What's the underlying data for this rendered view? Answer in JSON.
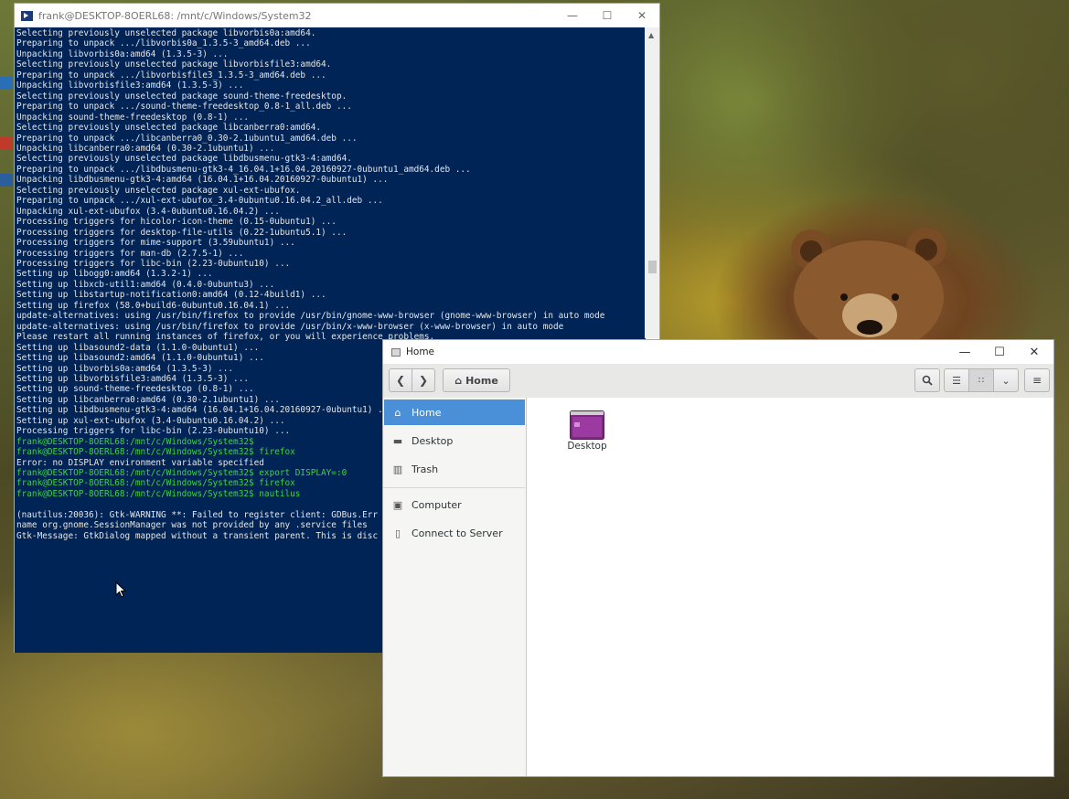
{
  "terminal": {
    "title": "frank@DESKTOP-8OERL68: /mnt/c/Windows/System32",
    "lines": [
      {
        "t": "Selecting previously unselected package libvorbis0a:amd64.",
        "c": "w"
      },
      {
        "t": "Preparing to unpack .../libvorbis0a_1.3.5-3_amd64.deb ...",
        "c": "w"
      },
      {
        "t": "Unpacking libvorbis0a:amd64 (1.3.5-3) ...",
        "c": "w"
      },
      {
        "t": "Selecting previously unselected package libvorbisfile3:amd64.",
        "c": "w"
      },
      {
        "t": "Preparing to unpack .../libvorbisfile3_1.3.5-3_amd64.deb ...",
        "c": "w"
      },
      {
        "t": "Unpacking libvorbisfile3:amd64 (1.3.5-3) ...",
        "c": "w"
      },
      {
        "t": "Selecting previously unselected package sound-theme-freedesktop.",
        "c": "w"
      },
      {
        "t": "Preparing to unpack .../sound-theme-freedesktop_0.8-1_all.deb ...",
        "c": "w"
      },
      {
        "t": "Unpacking sound-theme-freedesktop (0.8-1) ...",
        "c": "w"
      },
      {
        "t": "Selecting previously unselected package libcanberra0:amd64.",
        "c": "w"
      },
      {
        "t": "Preparing to unpack .../libcanberra0_0.30-2.1ubuntu1_amd64.deb ...",
        "c": "w"
      },
      {
        "t": "Unpacking libcanberra0:amd64 (0.30-2.1ubuntu1) ...",
        "c": "w"
      },
      {
        "t": "Selecting previously unselected package libdbusmenu-gtk3-4:amd64.",
        "c": "w"
      },
      {
        "t": "Preparing to unpack .../libdbusmenu-gtk3-4_16.04.1+16.04.20160927-0ubuntu1_amd64.deb ...",
        "c": "w"
      },
      {
        "t": "Unpacking libdbusmenu-gtk3-4:amd64 (16.04.1+16.04.20160927-0ubuntu1) ...",
        "c": "w"
      },
      {
        "t": "Selecting previously unselected package xul-ext-ubufox.",
        "c": "w"
      },
      {
        "t": "Preparing to unpack .../xul-ext-ubufox_3.4-0ubuntu0.16.04.2_all.deb ...",
        "c": "w"
      },
      {
        "t": "Unpacking xul-ext-ubufox (3.4-0ubuntu0.16.04.2) ...",
        "c": "w"
      },
      {
        "t": "Processing triggers for hicolor-icon-theme (0.15-0ubuntu1) ...",
        "c": "w"
      },
      {
        "t": "Processing triggers for desktop-file-utils (0.22-1ubuntu5.1) ...",
        "c": "w"
      },
      {
        "t": "Processing triggers for mime-support (3.59ubuntu1) ...",
        "c": "w"
      },
      {
        "t": "Processing triggers for man-db (2.7.5-1) ...",
        "c": "w"
      },
      {
        "t": "Processing triggers for libc-bin (2.23-0ubuntu10) ...",
        "c": "w"
      },
      {
        "t": "Setting up libogg0:amd64 (1.3.2-1) ...",
        "c": "w"
      },
      {
        "t": "Setting up libxcb-util1:amd64 (0.4.0-0ubuntu3) ...",
        "c": "w"
      },
      {
        "t": "Setting up libstartup-notification0:amd64 (0.12-4build1) ...",
        "c": "w"
      },
      {
        "t": "Setting up firefox (58.0+build6-0ubuntu0.16.04.1) ...",
        "c": "w"
      },
      {
        "t": "update-alternatives: using /usr/bin/firefox to provide /usr/bin/gnome-www-browser (gnome-www-browser) in auto mode",
        "c": "w"
      },
      {
        "t": "update-alternatives: using /usr/bin/firefox to provide /usr/bin/x-www-browser (x-www-browser) in auto mode",
        "c": "w"
      },
      {
        "t": "Please restart all running instances of firefox, or you will experience problems.",
        "c": "w"
      },
      {
        "t": "Setting up libasound2-data (1.1.0-0ubuntu1) ...",
        "c": "w"
      },
      {
        "t": "Setting up libasound2:amd64 (1.1.0-0ubuntu1) ...",
        "c": "w"
      },
      {
        "t": "Setting up libvorbis0a:amd64 (1.3.5-3) ...",
        "c": "w"
      },
      {
        "t": "Setting up libvorbisfile3:amd64 (1.3.5-3) ...",
        "c": "w"
      },
      {
        "t": "Setting up sound-theme-freedesktop (0.8-1) ...",
        "c": "w"
      },
      {
        "t": "Setting up libcanberra0:amd64 (0.30-2.1ubuntu1) ...",
        "c": "w"
      },
      {
        "t": "Setting up libdbusmenu-gtk3-4:amd64 (16.04.1+16.04.20160927-0ubuntu1) ...",
        "c": "w"
      },
      {
        "t": "Setting up xul-ext-ubufox (3.4-0ubuntu0.16.04.2) ...",
        "c": "w"
      },
      {
        "t": "Processing triggers for libc-bin (2.23-0ubuntu10) ...",
        "c": "w"
      },
      {
        "t": "frank@DESKTOP-8OERL68:/mnt/c/Windows/System32$",
        "c": "g"
      },
      {
        "t": "frank@DESKTOP-8OERL68:/mnt/c/Windows/System32$ firefox",
        "c": "g"
      },
      {
        "t": "Error: no DISPLAY environment variable specified",
        "c": "w"
      },
      {
        "t": "frank@DESKTOP-8OERL68:/mnt/c/Windows/System32$ export DISPLAY=:0",
        "c": "g"
      },
      {
        "t": "frank@DESKTOP-8OERL68:/mnt/c/Windows/System32$ firefox",
        "c": "g"
      },
      {
        "t": "frank@DESKTOP-8OERL68:/mnt/c/Windows/System32$ nautilus",
        "c": "g"
      },
      {
        "t": "",
        "c": "w"
      },
      {
        "t": "(nautilus:20036): Gtk-WARNING **: Failed to register client: GDBus.Err",
        "c": "w"
      },
      {
        "t": "name org.gnome.SessionManager was not provided by any .service files",
        "c": "w"
      },
      {
        "t": "Gtk-Message: GtkDialog mapped without a transient parent. This is disc",
        "c": "w"
      }
    ]
  },
  "nautilus": {
    "title": "Home",
    "location_button": "Home",
    "sidebar": [
      {
        "label": "Home",
        "icon": "home-icon",
        "selected": true
      },
      {
        "label": "Desktop",
        "icon": "folder-icon",
        "selected": false
      },
      {
        "label": "Trash",
        "icon": "trash-icon",
        "selected": false
      },
      {
        "label": "Computer",
        "icon": "computer-icon",
        "selected": false
      },
      {
        "label": "Connect to Server",
        "icon": "server-icon",
        "selected": false
      }
    ],
    "items": [
      {
        "label": "Desktop",
        "icon": "desktop-folder-icon"
      }
    ],
    "selected_color": "#4a90d9"
  }
}
